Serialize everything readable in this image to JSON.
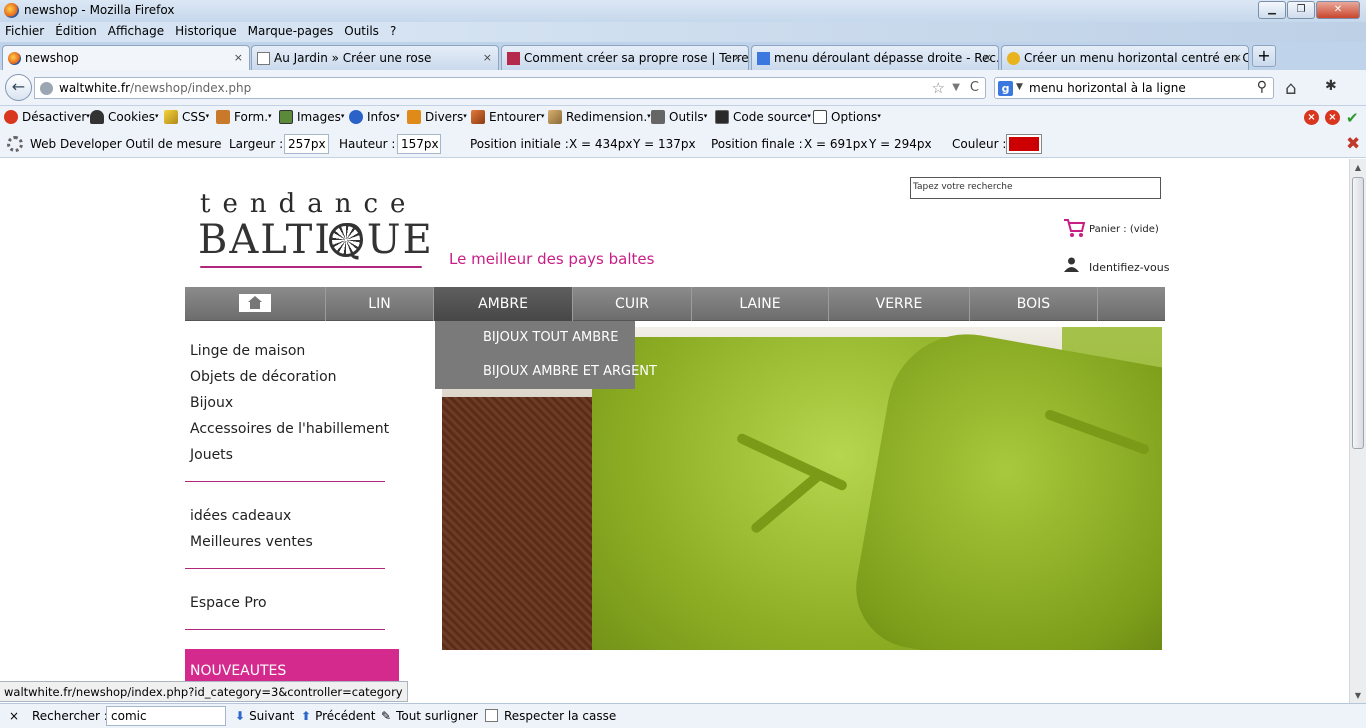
{
  "window": {
    "title": "newshop - Mozilla Firefox",
    "controls": {
      "minimize": "▁",
      "maximize": "❐",
      "close": "✕"
    }
  },
  "menubar": [
    "Fichier",
    "Édition",
    "Affichage",
    "Historique",
    "Marque-pages",
    "Outils",
    "?"
  ],
  "tabs": [
    {
      "label": "newshop",
      "active": true,
      "close": "×"
    },
    {
      "label": "Au Jardin » Créer une rose",
      "close": "×"
    },
    {
      "label": "Comment créer sa propre rose | Terre...",
      "close": "×"
    },
    {
      "label": "menu déroulant dépasse droite - Rec...",
      "close": "×"
    },
    {
      "label": "Créer un menu horizontal centré en C...",
      "close": "×"
    }
  ],
  "new_tab": "+",
  "navbar": {
    "back": "←",
    "url_domain": "waltwhite.fr",
    "url_path": "/newshop/index.php",
    "star": "☆",
    "dropdown": "▼",
    "reload": "C",
    "search_engine_letter": "g",
    "search_engine_dropdown": "▼",
    "search_value": "menu horizontal à la ligne",
    "search_icon": "⚲",
    "home": "⌂",
    "bug": "✱"
  },
  "webdev_toolbar": {
    "items": [
      "Désactiver",
      "Cookies",
      "CSS",
      "Form.",
      "Images",
      "Infos",
      "Divers",
      "Entourer",
      "Redimension.",
      "Outils",
      "Code source",
      "Options"
    ],
    "caret": "▾",
    "right_close_1": "×",
    "right_close_2": "×",
    "ok": "✔"
  },
  "measure_bar": {
    "title": "Web Developer  Outil de mesure",
    "width_label": "Largeur :",
    "width_value": "257px",
    "height_label": "Hauteur :",
    "height_value": "157px",
    "start_label": "Position initiale :",
    "start_x": "X =  434px",
    "start_y": "Y =  137px",
    "end_label": "Position finale :",
    "end_x": "X =  691px",
    "end_y": "Y =  294px",
    "color_label": "Couleur :",
    "color_value": "#cc0000",
    "close": "✖"
  },
  "page": {
    "logo_top": "tendance",
    "logo_bottom": "BALTIQUE",
    "tagline": "Le meilleur des pays baltes",
    "search_placeholder": "Tapez votre recherche",
    "cart": "Panier : (vide)",
    "login": "Identifiez-vous",
    "nav": [
      "LIN",
      "AMBRE",
      "CUIR",
      "LAINE",
      "VERRE",
      "BOIS"
    ],
    "nav_active": "AMBRE",
    "dropdown": [
      "BIJOUX TOUT AMBRE",
      "BIJOUX AMBRE ET ARGENT"
    ],
    "left_menu_1": [
      "Linge de maison",
      "Objets de décoration",
      "Bijoux",
      "Accessoires de l'habillement",
      "Jouets"
    ],
    "left_menu_2": [
      "idées cadeaux",
      "Meilleures ventes"
    ],
    "left_menu_3": [
      "Espace Pro"
    ],
    "new_label": "NOUVEAUTES",
    "accent_color": "#d42a8e"
  },
  "status_url": "waltwhite.fr/newshop/index.php?id_category=3&controller=category",
  "scrollbar": {
    "up": "▲",
    "down": "▼"
  },
  "findbar": {
    "close": "×",
    "label": "Rechercher :",
    "value": "comic",
    "next_arrow": "⬇",
    "next": "Suivant",
    "prev_arrow": "⬆",
    "prev": "Précédent",
    "highlight_icon": "✎",
    "highlight": "Tout surligner",
    "match_case": "Respecter la casse"
  }
}
